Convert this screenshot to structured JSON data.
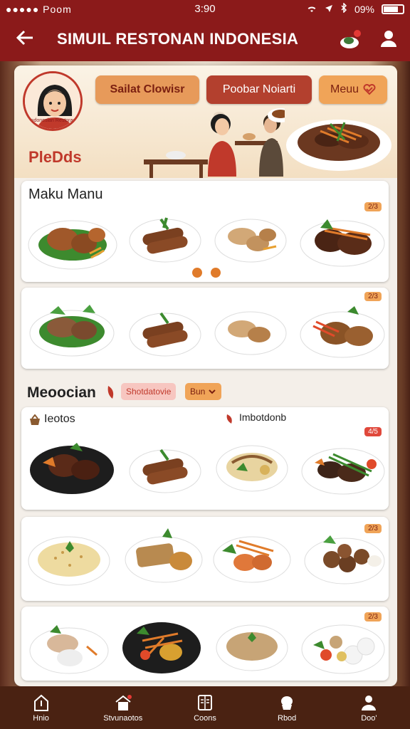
{
  "status": {
    "carrier": "●●●●● Poom",
    "time": "3:90",
    "battery": "09%"
  },
  "header": {
    "title": "SIMUIL RESTONAN INDONESIA"
  },
  "hero": {
    "avatar_caption": "Indonesian Restoran",
    "brand": "PleDds",
    "buttons": [
      "Sailat Clowisr",
      "Poobar Noiarti",
      "Meuu"
    ]
  },
  "sections": {
    "top_title": "Maku Manu",
    "top_badge": "2/3",
    "second_badge": "2/3",
    "mid_title": "Meoocian",
    "mid_tag1": "Shotdatovie",
    "mid_tag2": "Bun",
    "sub_left": "Ieotos",
    "sub_right": "Imbotdonb",
    "badge_a": "4/5",
    "badge_b": "2/3",
    "badge_c": "2/3"
  },
  "nav": [
    "Hnio",
    "Stvunaotos",
    "Coons",
    "Rbod",
    "Doo'"
  ],
  "colors": {
    "primary": "#8b1a1a",
    "accent": "#e79a5a",
    "nav": "#4a2212"
  }
}
